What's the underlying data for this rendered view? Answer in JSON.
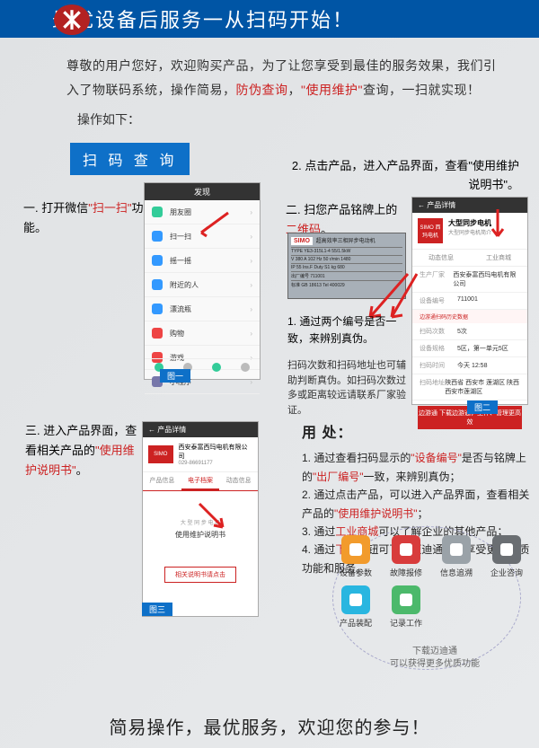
{
  "banner": {
    "title": "最优设备后服务一从扫码开始！"
  },
  "intro": {
    "line1a": "尊敬的用户您好，欢迎购买产品，为了让您享受到最佳的服务效果，我们引入了物联码系统，操作简易，",
    "hl1": "防伪查询",
    "mid": "，",
    "hl2": "\"使用维护\"",
    "line1b": "查询，一扫就实现！",
    "op": "操作如下："
  },
  "tag": {
    "label": "扫 码 查 询"
  },
  "step1": {
    "pre": "一. 打开微信",
    "quote": "\"扫一扫\"",
    "post": "功能。"
  },
  "phone1": {
    "title": "发现",
    "rows": [
      "朋友圈",
      "扫一扫",
      "摇一摇",
      "附近的人",
      "漂流瓶",
      "购物",
      "游戏",
      "小程序"
    ],
    "label": "图一"
  },
  "step2a": {
    "text": "2. 点击产品，进入产品界面，查看\"使用维护说明书\"。"
  },
  "step2": {
    "pre": "二. 扫您产品铭牌上的",
    "quote": "二维码",
    "post": "。"
  },
  "nameplate": {
    "brand": "SIMO",
    "title": "超高效率三相异步电动机",
    "rows": [
      "TYPE YE3-315L1-4  55/1.5kW",
      "V 380  A 102  Hz 50  r/min 1480",
      "IP 55  Ins.F  Duty S1  kg 680",
      "出厂编号 711001",
      "标准 GB 18613  Tel 400029"
    ]
  },
  "phone2": {
    "bar": "← 产品详情",
    "logo": "SIMO\n西玛电机",
    "title": "大型同步电机",
    "sub": "大型同步电机简介",
    "tabs": [
      "动态信息",
      "工业商城"
    ],
    "kv": [
      {
        "k": "生产厂家",
        "v": "西安泰富西玛电机有限公司"
      },
      {
        "k": "设备编号",
        "v": "711001",
        "red": true
      },
      {
        "k": "扫码次数",
        "v": "5次"
      },
      {
        "k": "设备规格",
        "v": "5区，第一单元5区"
      },
      {
        "k": "扫码时间",
        "v": "今天 12:58"
      },
      {
        "k": "扫码地址",
        "v": "陕西省 西安市 莲湖区 陕西西安市莲湖区"
      }
    ],
    "dl": "边游通  下载边游通，工作、管理更高效",
    "label": "图二"
  },
  "note1": {
    "text": "1. 通过两个编号是否一致，来辨别真伪。"
  },
  "note2": {
    "text": "扫码次数和扫码地址也可辅助判断真伪。如扫码次数过多或距离较远请联系厂家验证。"
  },
  "step3": {
    "pre": "三. 进入产品界面，查看相关产品的",
    "quote": "\"使用维护说明书\"",
    "post": "。"
  },
  "phone3": {
    "bar": "← 产品详情",
    "logo": "SIMO",
    "company": "西安泰富西玛电机有限公司",
    "phone": "029-86691177",
    "tabs": [
      "产品信息",
      "电子档案",
      "动态信息"
    ],
    "doc_sub": "大 型 同 步 电 机",
    "doc_title": "使用维护说明书",
    "btn": "相关说明书请点击",
    "label": "图三"
  },
  "uses": {
    "title": "用 处：",
    "l1a": "1. 通过查看扫码显示的",
    "l1q1": "\"设备编号\"",
    "l1b": "是否与铭牌上的",
    "l1q2": "\"出厂编号\"",
    "l1c": "一致，来辨别真伪；",
    "l2a": "2. 通过点击产品，可以进入产品界面，查看相关产品的",
    "l2q": "\"使用维护说明书\"",
    "l2b": "；",
    "l3a": "3. 通过",
    "l3q": "工业商城",
    "l3b": "可以了解企业的其他产品；",
    "l4a": "4. 通过",
    "l4q": "下载",
    "l4b": "按钮可下载迈迪通APP享受更多优质功能和服务。"
  },
  "appicons": {
    "items": [
      "设备参数",
      "故障报修",
      "信息追溯",
      "企业咨询",
      "产品装配",
      "记录工作"
    ],
    "dl1": "下载迈迪通",
    "dl2": "可以获得更多优质功能"
  },
  "footer": {
    "text": "简易操作，最优服务，欢迎您的参与！"
  }
}
